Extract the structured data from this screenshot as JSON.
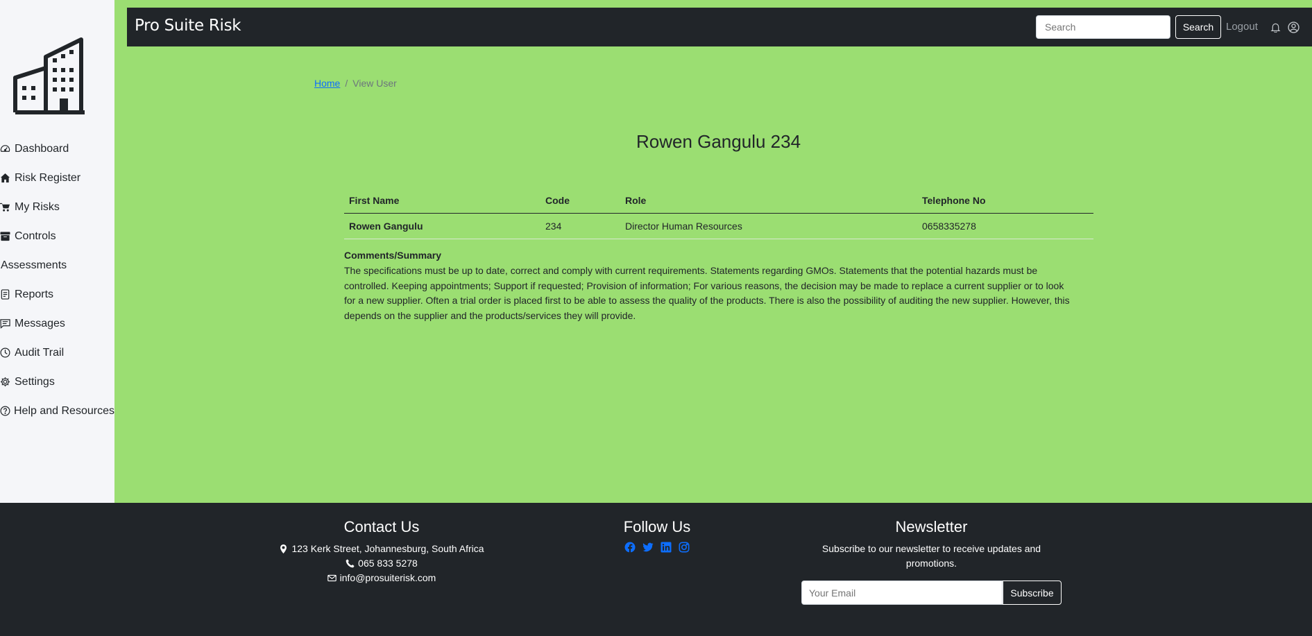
{
  "header": {
    "brand": "Pro Suite Risk",
    "search_placeholder": "Search",
    "search_button": "Search",
    "logout": "Logout"
  },
  "sidebar": {
    "items": [
      {
        "label": "Dashboard",
        "icon": "speedometer-icon"
      },
      {
        "label": "Risk Register",
        "icon": "house-icon"
      },
      {
        "label": "My Risks",
        "icon": "cart-icon"
      },
      {
        "label": "Controls",
        "icon": "archive-icon"
      },
      {
        "label": "Assessments",
        "icon": ""
      },
      {
        "label": "Reports",
        "icon": "file-text-icon"
      },
      {
        "label": "Messages",
        "icon": "chat-icon"
      },
      {
        "label": "Audit Trail",
        "icon": "clock-icon"
      },
      {
        "label": "Settings",
        "icon": "gear-icon"
      },
      {
        "label": "Help and Resources",
        "icon": "question-circle-icon"
      }
    ]
  },
  "breadcrumb": {
    "home": "Home",
    "current": "View User"
  },
  "page": {
    "title": "Rowen Gangulu 234"
  },
  "table": {
    "headers": [
      "First Name",
      "Code",
      "Role",
      "Telephone No"
    ],
    "row": [
      "Rowen Gangulu",
      "234",
      "Director Human Resources",
      "0658335278"
    ]
  },
  "comments": {
    "title": "Comments/Summary",
    "text": "The specifications must be up to date, correct and comply with current requirements. Statements regarding GMOs. Statements that the potential hazards must be controlled. Keeping appointments; Support if requested; Provision of information; For various reasons, the decision may be made to replace a current supplier or to look for a new supplier. Often a trial order is placed first to be able to assess the quality of the products. There is also the possibility of auditing the new supplier. However, this depends on the supplier and the products/services they will provide."
  },
  "footer": {
    "contact_title": "Contact Us",
    "address": "123 Kerk Street, Johannesburg, South Africa",
    "phone": "065 833 5278",
    "email": "info@prosuiterisk.com",
    "follow_title": "Follow Us",
    "newsletter_title": "Newsletter",
    "newsletter_text": "Subscribe to our newsletter to receive updates and promotions.",
    "newsletter_placeholder": "Your Email",
    "subscribe_button": "Subscribe"
  },
  "colors": {
    "page_bg": "#9bde72",
    "dark": "#212529",
    "sidebar_bg": "#f5f6f9",
    "social_icon": "#0d6efd"
  }
}
